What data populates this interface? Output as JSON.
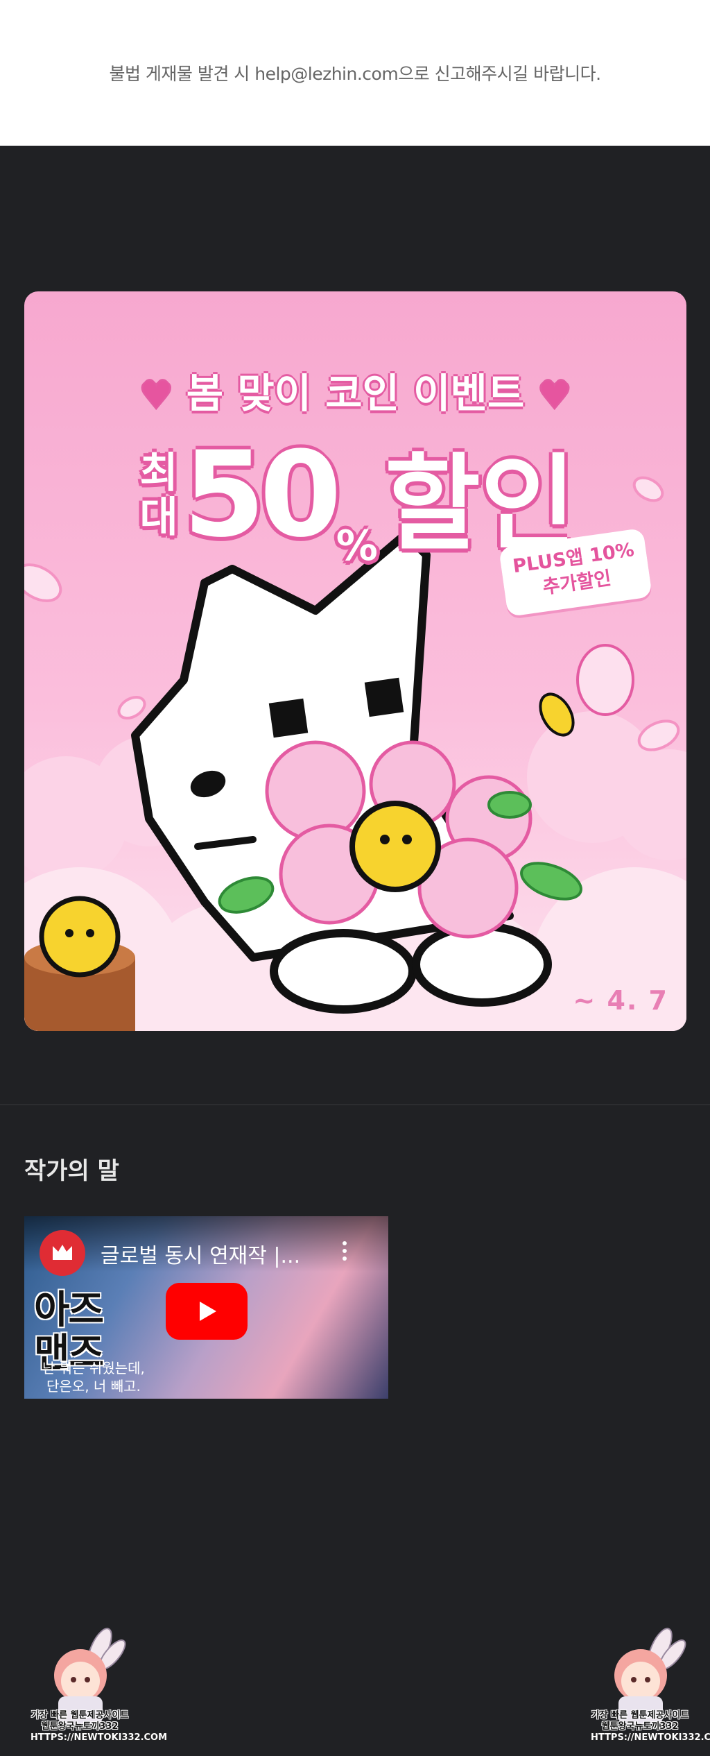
{
  "notice": {
    "text": "불법 게재물 발견 시 help@lezhin.com으로 신고해주시길 바랍니다."
  },
  "banner": {
    "headline": "봄 맞이 코인 이벤트",
    "big_prefix_top": "최",
    "big_prefix_bottom": "대",
    "big_number": "50",
    "big_percent": "%",
    "big_word": "할인",
    "tag_line1": "PLUS앱 10%",
    "tag_line2": "추가할인",
    "date": "~ 4. 7",
    "colors": {
      "pink_dark": "#e45ba2",
      "pink_bg": "#f7a8cf",
      "flower": "#f6b4d6"
    }
  },
  "author_section": {
    "title": "작가의 말"
  },
  "video": {
    "title": "글로벌 동시 연재작 |...",
    "promo_line1": "아즈",
    "promo_line2": "맨즈",
    "promo_sub1": "난 뭐든 쉬웠는데,",
    "promo_sub2": "단은오, 너 빼고.",
    "play_icon": "play-icon",
    "menu_icon": "more-vert-icon"
  },
  "ads": {
    "line1": "가장 빠른 웹툰제공사이트",
    "line2": "웹툰왕국뉴토끼332",
    "line3": "HTTPS://NEWTOKI332.COM"
  }
}
